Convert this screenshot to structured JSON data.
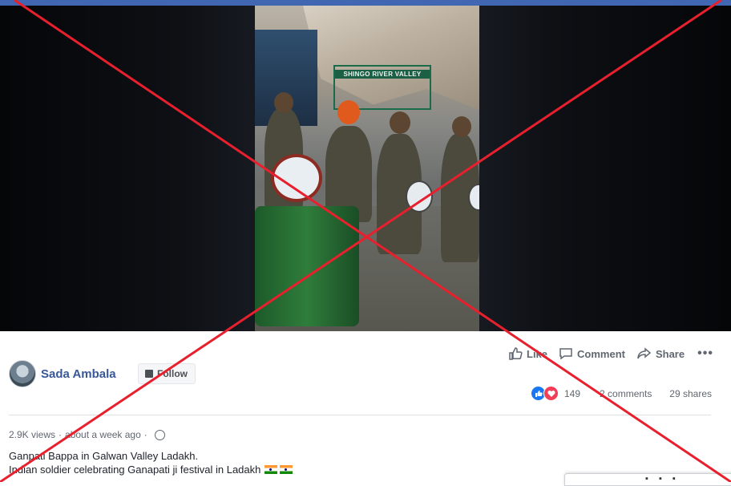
{
  "video": {
    "sign_text": "SHINGO RIVER VALLEY"
  },
  "post": {
    "author_name": "Sada Ambala",
    "follow_label": "Follow",
    "actions": {
      "like_label": "Like",
      "comment_label": "Comment",
      "share_label": "Share"
    },
    "stats": {
      "reaction_count": "149",
      "comments": "2 comments",
      "shares": "29 shares"
    },
    "meta": {
      "views": "2.9K views",
      "separator": "·",
      "time": "about a week ago",
      "separator2": "·"
    },
    "caption": {
      "line1": "Ganpati Bappa in Galwan Valley Ladakh.",
      "line2": "Indian soldier celebrating Ganapati ji festival in Ladakh"
    }
  },
  "colors": {
    "brand_blue": "#4267b2",
    "author_link": "#385898",
    "cross_red": "#e8202e"
  }
}
